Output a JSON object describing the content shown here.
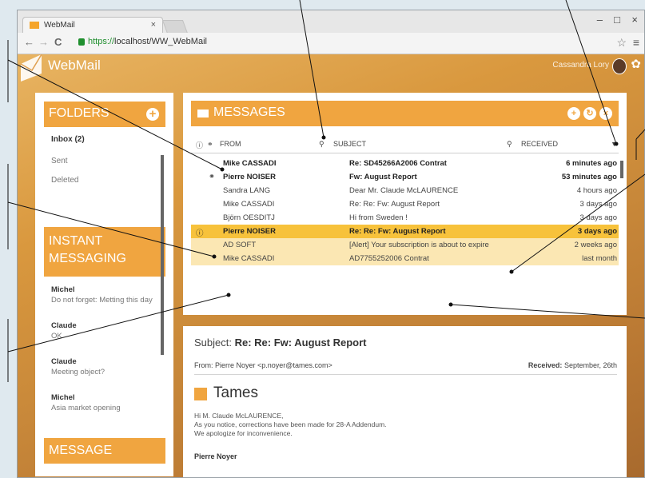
{
  "browser": {
    "tab_title": "WebMail",
    "tab_close": "×",
    "url_prefix": "https://",
    "url_rest": "localhost/WW_WebMail",
    "minimize": "–",
    "maximize": "□",
    "close": "×"
  },
  "app": {
    "name": "WebMail",
    "user": "Cassandra Lory",
    "accent": "#f0a540"
  },
  "folders": {
    "title": "FOLDERS",
    "items": [
      {
        "label": "Inbox (2)"
      },
      {
        "label": "Sent"
      },
      {
        "label": "Deleted"
      }
    ]
  },
  "instant_messaging": {
    "title_line1": "INSTANT",
    "title_line2": "MESSAGING",
    "messages": [
      {
        "name": "Michel",
        "text": "Do not forget: Metting this day"
      },
      {
        "name": "Claude",
        "text": "OK"
      },
      {
        "name": "Claude",
        "text": "Meeting object?"
      },
      {
        "name": "Michel",
        "text": "Asia market opening"
      }
    ]
  },
  "message_section": {
    "title": "MESSAGE"
  },
  "messages": {
    "title": "MESSAGES",
    "columns": {
      "from": "FROM",
      "subject": "SUBJECT",
      "received": "RECEIVED"
    },
    "rows": [
      {
        "from": "Mike CASSADI",
        "subject": "Re: SD45266A2006 Contrat",
        "received": "6 minutes ago"
      },
      {
        "from": "Pierre NOISER",
        "subject": "Fw: August Report",
        "received": "53 minutes ago"
      },
      {
        "from": "Sandra LANG",
        "subject": "Dear Mr. Claude McLAURENCE",
        "received": "4 hours ago"
      },
      {
        "from": "Mike CASSADI",
        "subject": "Re: Re: Fw: August Report",
        "received": "3 days ago"
      },
      {
        "from": "Björn OESDITJ",
        "subject": "Hi from Sweden !",
        "received": "3 days ago"
      },
      {
        "from": "Pierre NOISER",
        "subject": "Re: Re: Fw: August Report",
        "received": "3 days ago"
      },
      {
        "from": "AD SOFT",
        "subject": "[Alert] Your subscription is about to expire",
        "received": "2 weeks ago"
      },
      {
        "from": "Mike CASSADI",
        "subject": "AD7755252006 Contrat",
        "received": "last month"
      }
    ]
  },
  "preview": {
    "subject_label": "Subject:",
    "subject": "Re: Re: Fw: August Report",
    "from_label": "From:",
    "from": "Pierre Noyer <p.noyer@tames.com>",
    "received_label": "Received:",
    "received": "September, 26th",
    "company": "Tames",
    "line1": "Hi M. Claude McLAURENCE,",
    "line2": "As you notice, corrections have been made for 28-A Addendum.",
    "line3": "We apologize for inconvenience.",
    "signature": "Pierre Noyer"
  }
}
